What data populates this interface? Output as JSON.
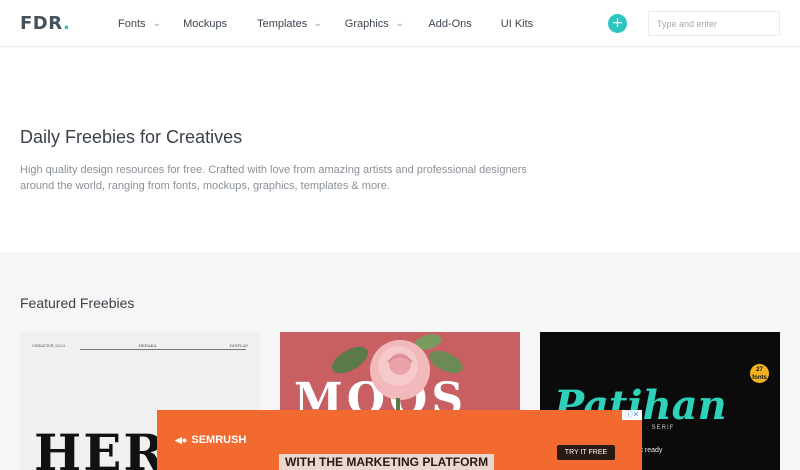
{
  "header": {
    "logo": "FDR",
    "logo_dot": ".",
    "nav": [
      {
        "label": "Fonts",
        "has_dropdown": true
      },
      {
        "label": "Mockups",
        "has_dropdown": false
      },
      {
        "label": "Templates",
        "has_dropdown": true
      },
      {
        "label": "Graphics",
        "has_dropdown": true
      },
      {
        "label": "Add-Ons",
        "has_dropdown": false
      },
      {
        "label": "UI Kits",
        "has_dropdown": false
      }
    ],
    "add_icon": "+",
    "search_placeholder": "Type and enter"
  },
  "hero": {
    "title": "Daily Freebies for Creatives",
    "description": "High quality design resources for free. Crafted with love from amazing artists and professional designers around the world, ranging from fonts, mockups, graphics, templates & more."
  },
  "featured": {
    "title": "Featured Freebies",
    "cards": [
      {
        "topbar_left": "CREATIVE 2023",
        "topbar_mid": "HERAKA",
        "topbar_right": "DISPLAY",
        "big_text": "HERA"
      },
      {
        "big_text": "MOOS"
      },
      {
        "big_text": "Patihan",
        "badge": "27 fonts",
        "sub": "SLAB · SERIF",
        "note": "ble font ready"
      }
    ]
  },
  "ad": {
    "brand": "SEMRUSH",
    "tagline": "WITH THE MARKETING PLATFORM",
    "cta": "TRY IT FREE",
    "close": "ⓘ✕"
  },
  "colors": {
    "accent": "#2ec4b6",
    "ad_bg": "#f26a2f",
    "featured_bg": "#f6f6f6"
  }
}
